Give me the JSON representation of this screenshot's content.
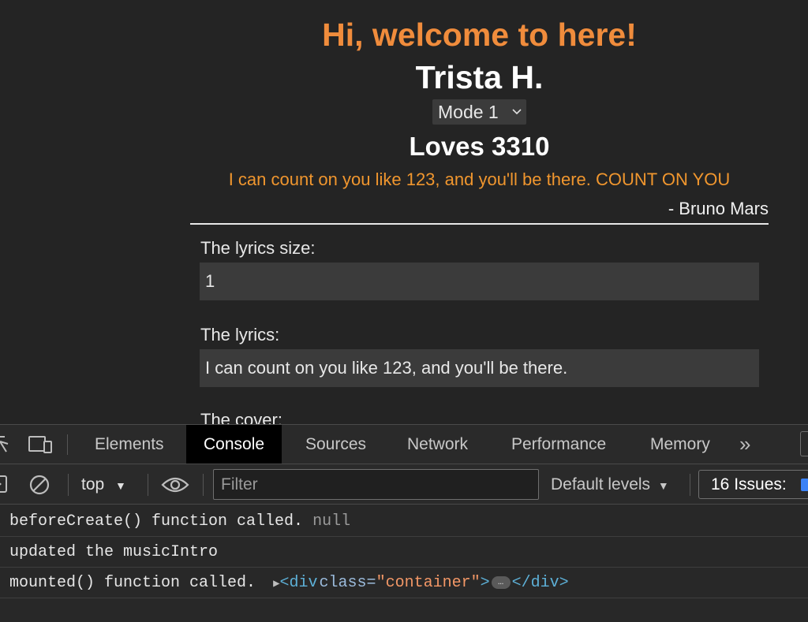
{
  "page": {
    "welcome": "Hi, welcome to here!",
    "name": "Trista H.",
    "mode_select": {
      "selected": "Mode 1",
      "chevron": "⌵"
    },
    "loves": "Loves 3310",
    "quote": "I can count on you like 123, and you'll be there. COUNT ON YOU",
    "author": "- Bruno Mars",
    "form": {
      "size_label": "The lyrics size:",
      "size_value": "1",
      "lyrics_label": "The lyrics:",
      "lyrics_value": "I can count on you like 123, and you'll be there.",
      "cover_label": "The cover:"
    },
    "colors": {
      "accent_orange": "#f08c3c",
      "quote_orange": "#f0962e",
      "background": "#242424"
    }
  },
  "devtools": {
    "tabs": [
      {
        "label": "Elements"
      },
      {
        "label": "Console"
      },
      {
        "label": "Sources"
      },
      {
        "label": "Network"
      },
      {
        "label": "Performance"
      },
      {
        "label": "Memory"
      }
    ],
    "active_tab": "Console",
    "more_tabs": "»",
    "toolbar": {
      "context": "top",
      "filter_placeholder": "Filter",
      "levels": "Default levels",
      "issues": "16 Issues:"
    },
    "console": {
      "row1_text": "beforeCreate() function called.",
      "row1_null": "null",
      "row2_text": "updated the musicIntro",
      "row3_text": "mounted() function called.",
      "row3_tag_open": "<div",
      "row3_attr": "class=",
      "row3_attrval": "\"container\"",
      "row3_tag_gt": ">",
      "row3_ellipsis": "…",
      "row3_tag_close": "</div>"
    }
  }
}
